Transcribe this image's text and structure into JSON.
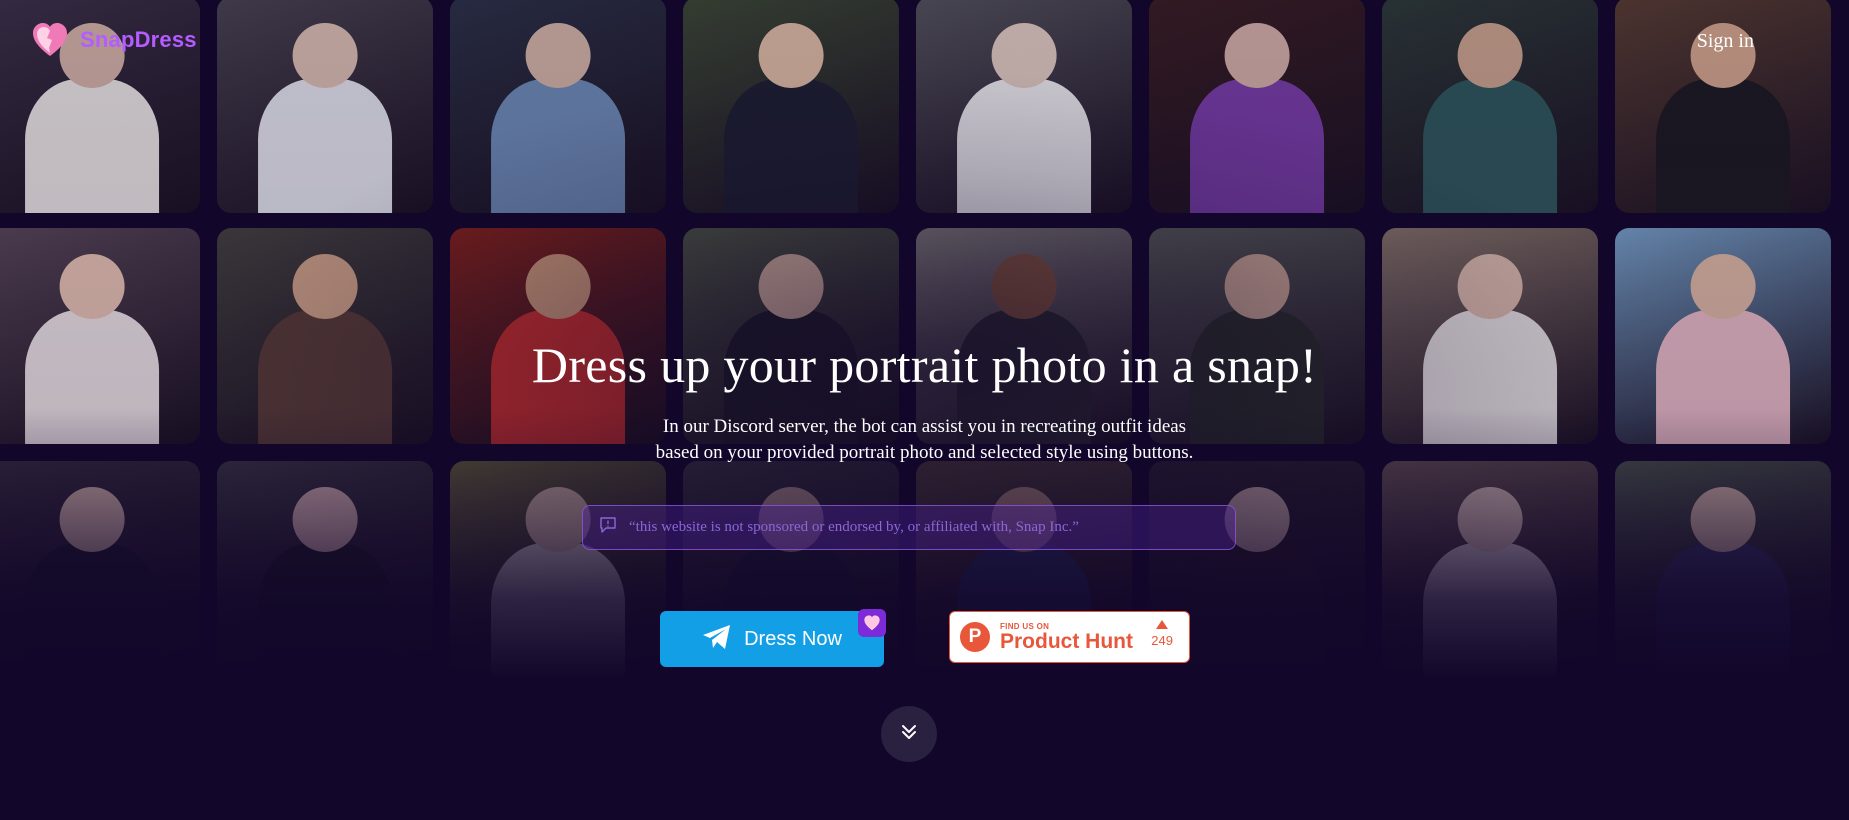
{
  "brand": {
    "name": "SnapDress",
    "accent": "#b45cff"
  },
  "header": {
    "signin_label": "Sign in"
  },
  "hero": {
    "title": "Dress up your portrait photo in a snap!",
    "subtitle_line1": "In our Discord server, the bot can assist you in recreating outfit ideas",
    "subtitle_line2": "based on your provided portrait photo and selected style using buttons."
  },
  "notice": {
    "icon": "message-icon",
    "text": "“this website is not sponsored or endorsed by, or affiliated with, Snap Inc.”"
  },
  "cta": {
    "dress_label": "Dress Now",
    "dress_icon": "telegram-icon",
    "dress_color": "#129fe6"
  },
  "product_hunt": {
    "small_label": "FIND US ON",
    "big_label": "Product Hunt",
    "logo_letter": "P",
    "votes": "249",
    "color": "#e8573a"
  },
  "scroll": {
    "icon": "double-chevron-down-icon"
  },
  "gallery": {
    "tiles": [
      {
        "bg": "#3d3347",
        "skin": "#d9b8a8",
        "outfit": "#f0ece8"
      },
      {
        "bg": "#4a4550",
        "skin": "#e0c3b3",
        "outfit": "#e8eaf0"
      },
      {
        "bg": "#2b3346",
        "skin": "#d7b9a8",
        "outfit": "#6f8fb8"
      },
      {
        "bg": "#3c4a33",
        "skin": "#e2c0a6",
        "outfit": "#1d2030"
      },
      {
        "bg": "#55555c",
        "skin": "#e5cfc2",
        "outfit": "#f3f3f3"
      },
      {
        "bg": "#3a1e20",
        "skin": "#d8b4aa",
        "outfit": "#7a3fa8"
      },
      {
        "bg": "#2d3c36",
        "skin": "#cfa98f",
        "outfit": "#2f5a5c"
      },
      {
        "bg": "#5a3f30",
        "skin": "#d8aa8e",
        "outfit": "#1b1b1f"
      },
      {
        "bg": "#5b4a58",
        "skin": "#f0cbb8",
        "outfit": "#f4ecec"
      },
      {
        "bg": "#45433e",
        "skin": "#d6a98a",
        "outfit": "#5a3e35"
      },
      {
        "bg": "#8a2418",
        "skin": "#d8a27c",
        "outfit": "#d6332b"
      },
      {
        "bg": "#515b45",
        "skin": "#e8c4a8",
        "outfit": "#1f1f25"
      },
      {
        "bg": "#8a8780",
        "skin": "#8c5b3c",
        "outfit": "#2c2c30"
      },
      {
        "bg": "#5b6059",
        "skin": "#d5b09a",
        "outfit": "#2b3029"
      },
      {
        "bg": "#8d7b6c",
        "skin": "#e7c6b3",
        "outfit": "#f5f1ee"
      },
      {
        "bg": "#7aa6cc",
        "skin": "#e6c0a8",
        "outfit": "#f2c3cc"
      },
      {
        "bg": "#3a3040",
        "skin": "#e6c6b6",
        "outfit": "#1c1c2a"
      },
      {
        "bg": "#3e3a45",
        "skin": "#ecc6c0",
        "outfit": "#1d1d22"
      },
      {
        "bg": "#6b6a3a",
        "skin": "#ecd0b6",
        "outfit": "#f1ede2"
      },
      {
        "bg": "#3e3c44",
        "skin": "#d8b6a2",
        "outfit": "#1e2333"
      },
      {
        "bg": "#5a4c3c",
        "skin": "#d2a88c",
        "outfit": "#2c3d70"
      },
      {
        "bg": "#2f2633",
        "skin": "#e2c4b8",
        "outfit": "#2a2028"
      },
      {
        "bg": "#6f5b58",
        "skin": "#efd3c6",
        "outfit": "#f1e6e8"
      },
      {
        "bg": "#4e5a4e",
        "skin": "#e7c8b4",
        "outfit": "#3a3d6a"
      }
    ]
  }
}
